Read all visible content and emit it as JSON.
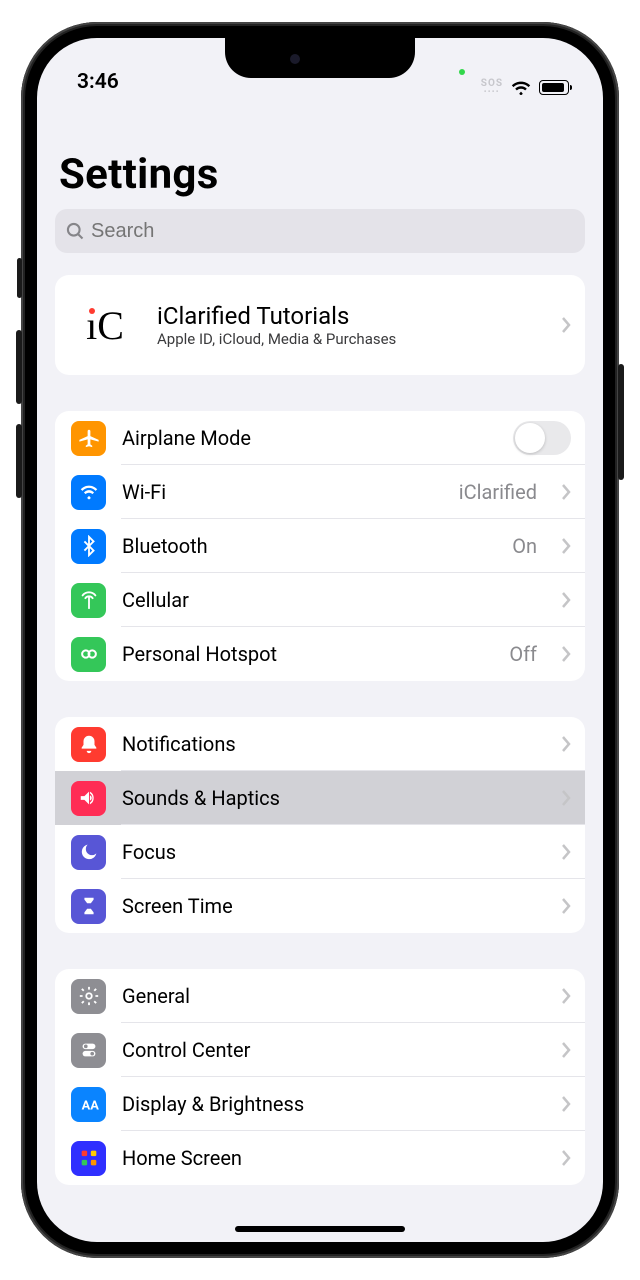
{
  "status": {
    "time": "3:46",
    "sos": "SOS"
  },
  "page": {
    "title": "Settings",
    "search_placeholder": "Search"
  },
  "account": {
    "avatar": "iC",
    "name": "iClarified Tutorials",
    "subtitle": "Apple ID, iCloud, Media & Purchases"
  },
  "g1": {
    "airplane": "Airplane Mode",
    "wifi": "Wi-Fi",
    "wifi_value": "iClarified",
    "bluetooth": "Bluetooth",
    "bluetooth_value": "On",
    "cellular": "Cellular",
    "hotspot": "Personal Hotspot",
    "hotspot_value": "Off"
  },
  "g2": {
    "notifications": "Notifications",
    "sounds": "Sounds & Haptics",
    "focus": "Focus",
    "screentime": "Screen Time"
  },
  "g3": {
    "general": "General",
    "control": "Control Center",
    "display": "Display & Brightness",
    "home": "Home Screen"
  }
}
